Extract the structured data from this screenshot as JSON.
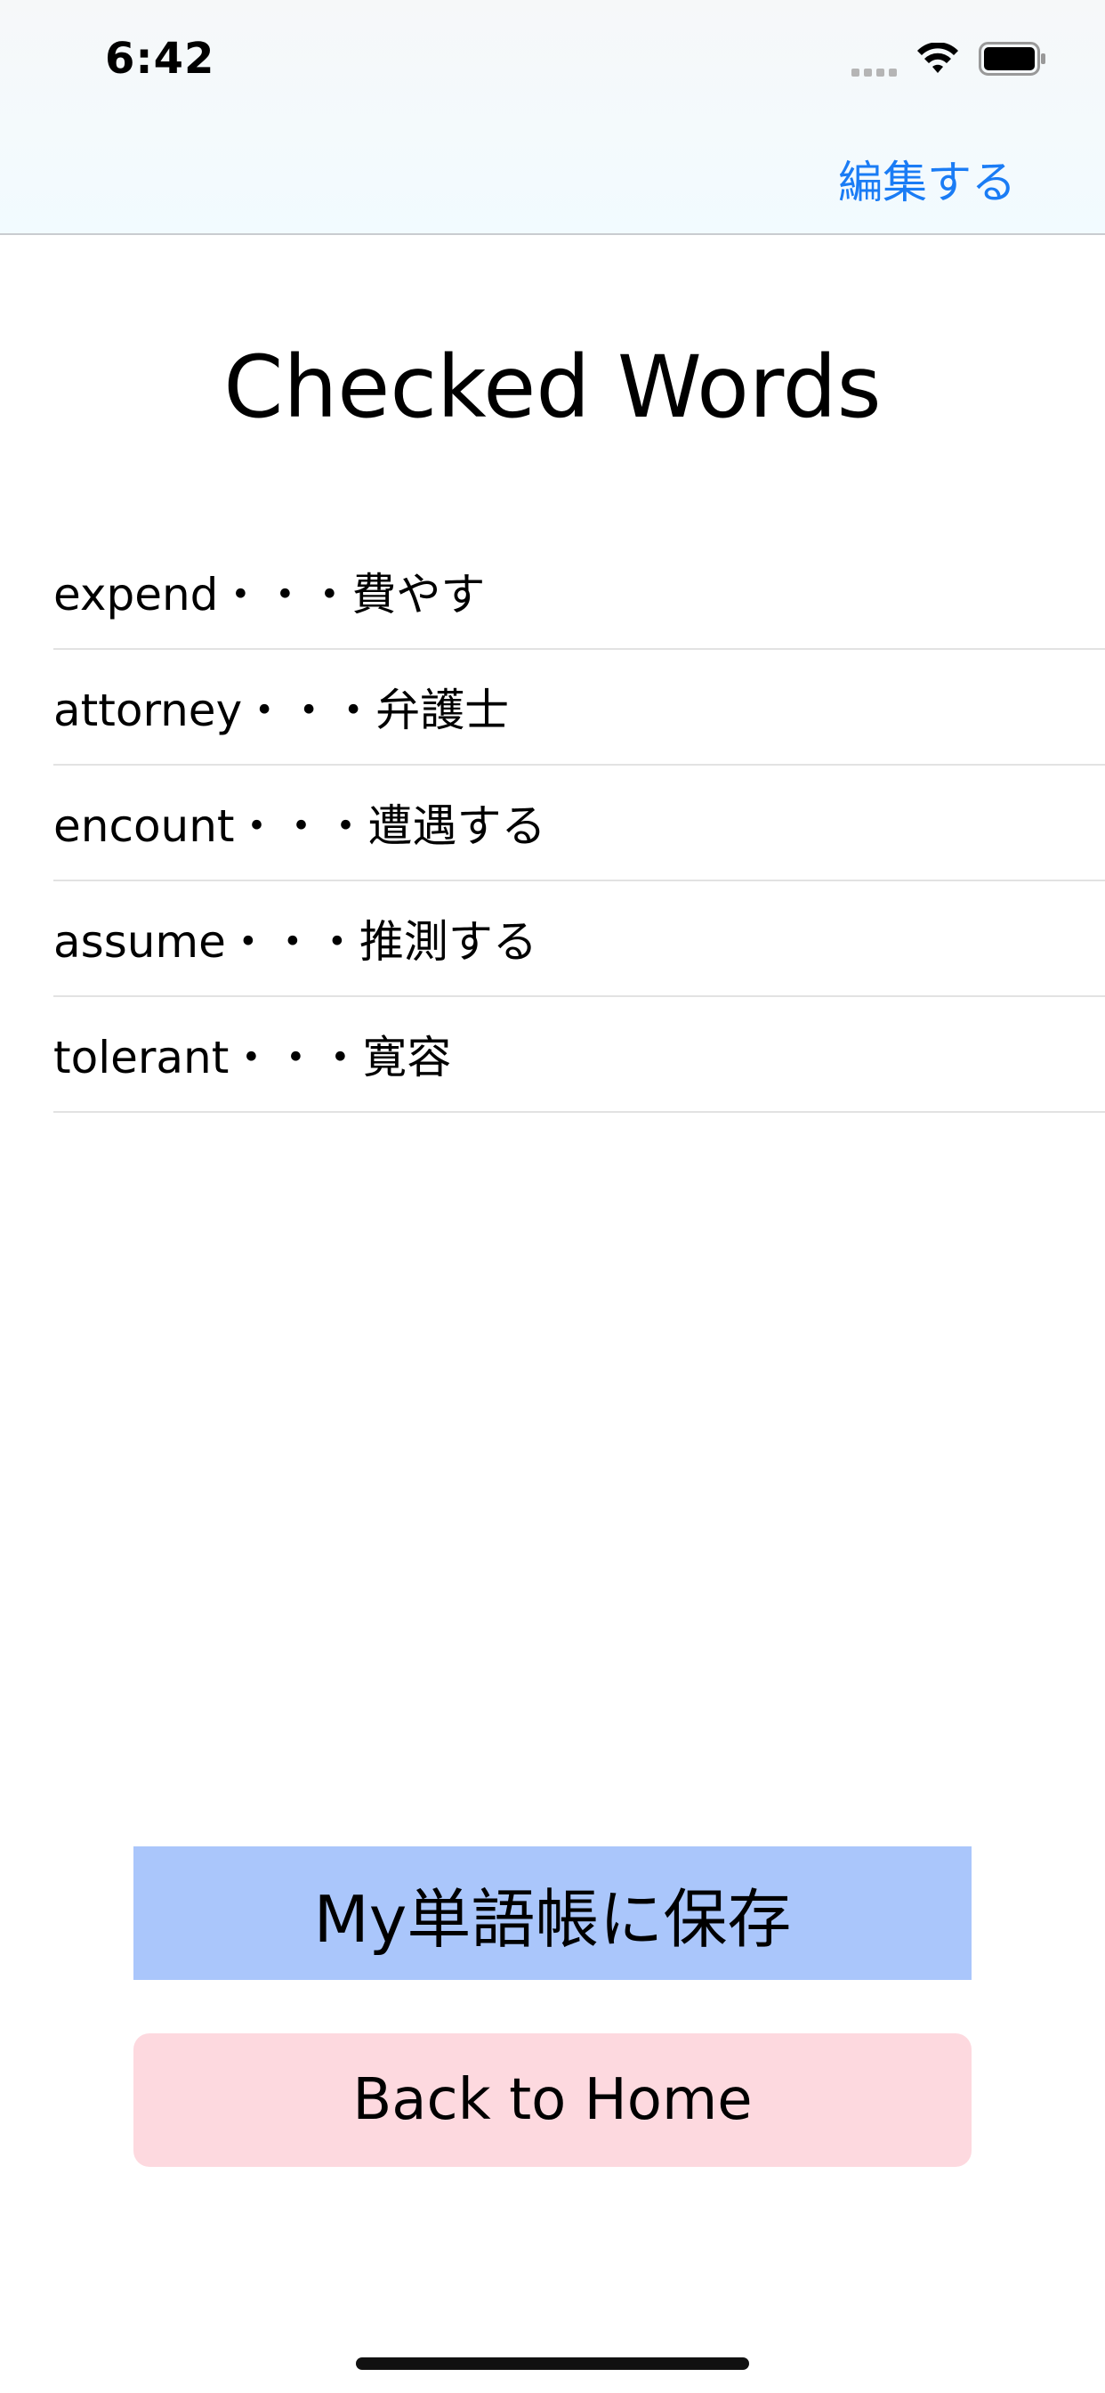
{
  "status_bar": {
    "time": "6:42"
  },
  "nav": {
    "edit_label": "編集する"
  },
  "page": {
    "title": "Checked Words"
  },
  "words": [
    "expend・・・費やす",
    "attorney・・・弁護士",
    "encount・・・遭遇する",
    "assume・・・推測する",
    "tolerant・・・寛容"
  ],
  "buttons": {
    "save_label": "My単語帳に保存",
    "home_label": "Back to Home"
  },
  "colors": {
    "accent": "#1a7cf5",
    "save_bg": "#aac6fb",
    "home_bg": "#fdd9df"
  },
  "icons": [
    "signal-icon",
    "wifi-icon",
    "battery-icon"
  ]
}
